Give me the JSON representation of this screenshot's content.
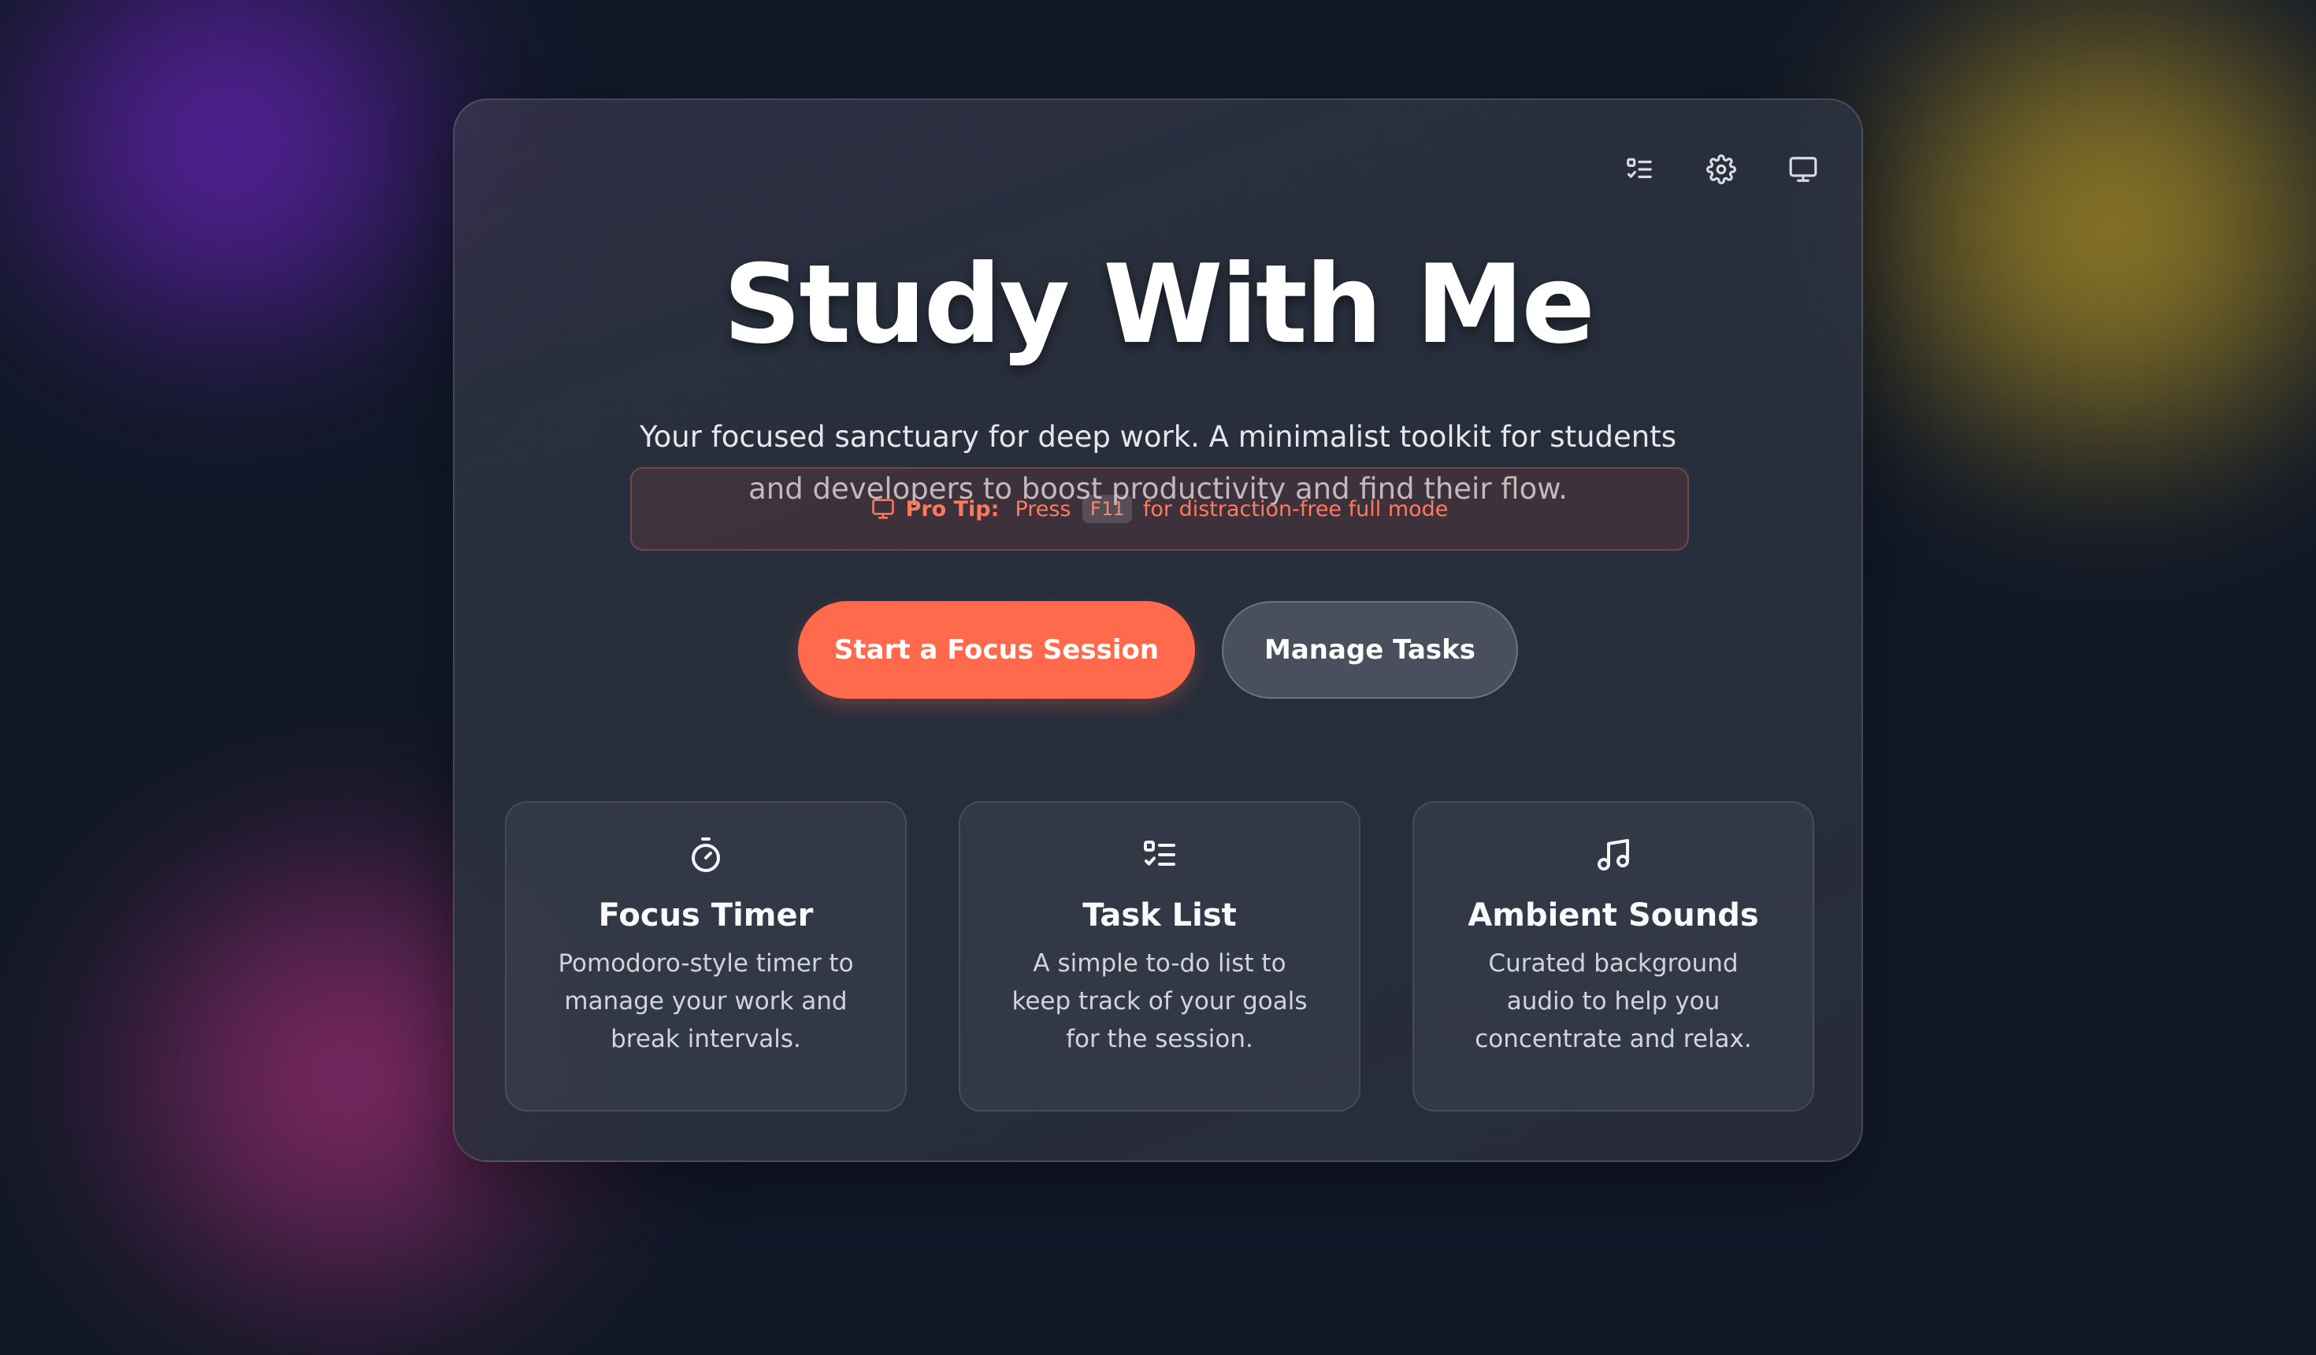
{
  "app": {
    "title": "Study With Me",
    "subtitle": "Your focused sanctuary for deep work. A minimalist toolkit for students and developers to boost productivity and find their flow."
  },
  "toolbar": {
    "icons": [
      "list-check-icon",
      "gear-icon",
      "monitor-icon"
    ]
  },
  "pro_tip": {
    "icon": "monitor-icon",
    "label": "Pro Tip:",
    "before_key": "Press",
    "key": "F11",
    "after_key": "for distraction-free full mode"
  },
  "actions": {
    "primary_label": "Start a Focus Session",
    "secondary_label": "Manage Tasks"
  },
  "features": [
    {
      "icon": "stopwatch-icon",
      "title": "Focus Timer",
      "description": "Pomodoro-style timer to manage your work and break intervals."
    },
    {
      "icon": "list-check-icon",
      "title": "Task List",
      "description": "A simple to-do list to keep track of your goals for the session."
    },
    {
      "icon": "music-note-icon",
      "title": "Ambient Sounds",
      "description": "Curated background audio to help you concentrate and relax."
    }
  ],
  "colors": {
    "accent": "#ff6a4d",
    "background": "#111827",
    "tip_text": "#ff7a5c"
  }
}
